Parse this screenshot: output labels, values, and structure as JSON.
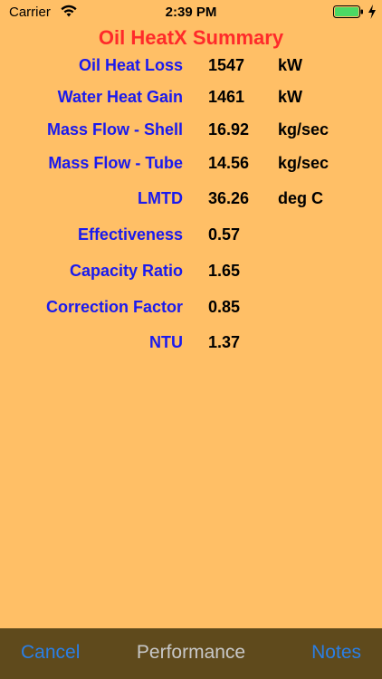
{
  "status_bar": {
    "carrier": "Carrier",
    "time": "2:39 PM",
    "battery_color": "#4cd964"
  },
  "title": "Oil HeatX Summary",
  "rows": [
    {
      "label": "Oil Heat Loss",
      "value": "1547",
      "unit": "kW"
    },
    {
      "label": "Water Heat Gain",
      "value": "1461",
      "unit": "kW"
    },
    {
      "label": "Mass Flow - Shell",
      "value": "16.92",
      "unit": "kg/sec"
    },
    {
      "label": "Mass Flow - Tube",
      "value": "14.56",
      "unit": "kg/sec"
    },
    {
      "label": "LMTD",
      "value": "36.26",
      "unit": "deg C"
    },
    {
      "label": "Effectiveness",
      "value": "0.57",
      "unit": ""
    },
    {
      "label": "Capacity Ratio",
      "value": "1.65",
      "unit": ""
    },
    {
      "label": "Correction Factor",
      "value": "0.85",
      "unit": ""
    },
    {
      "label": "NTU",
      "value": "1.37",
      "unit": ""
    }
  ],
  "toolbar": {
    "cancel_label": "Cancel",
    "performance_label": "Performance",
    "notes_label": "Notes"
  },
  "colors": {
    "background": "#ffbf66",
    "title": "#ff2a2a",
    "label": "#1a1aee",
    "toolbar_bg": "#5f4a1c",
    "toolbar_button": "#2a7fe6",
    "toolbar_disabled": "#c8c8c8"
  }
}
